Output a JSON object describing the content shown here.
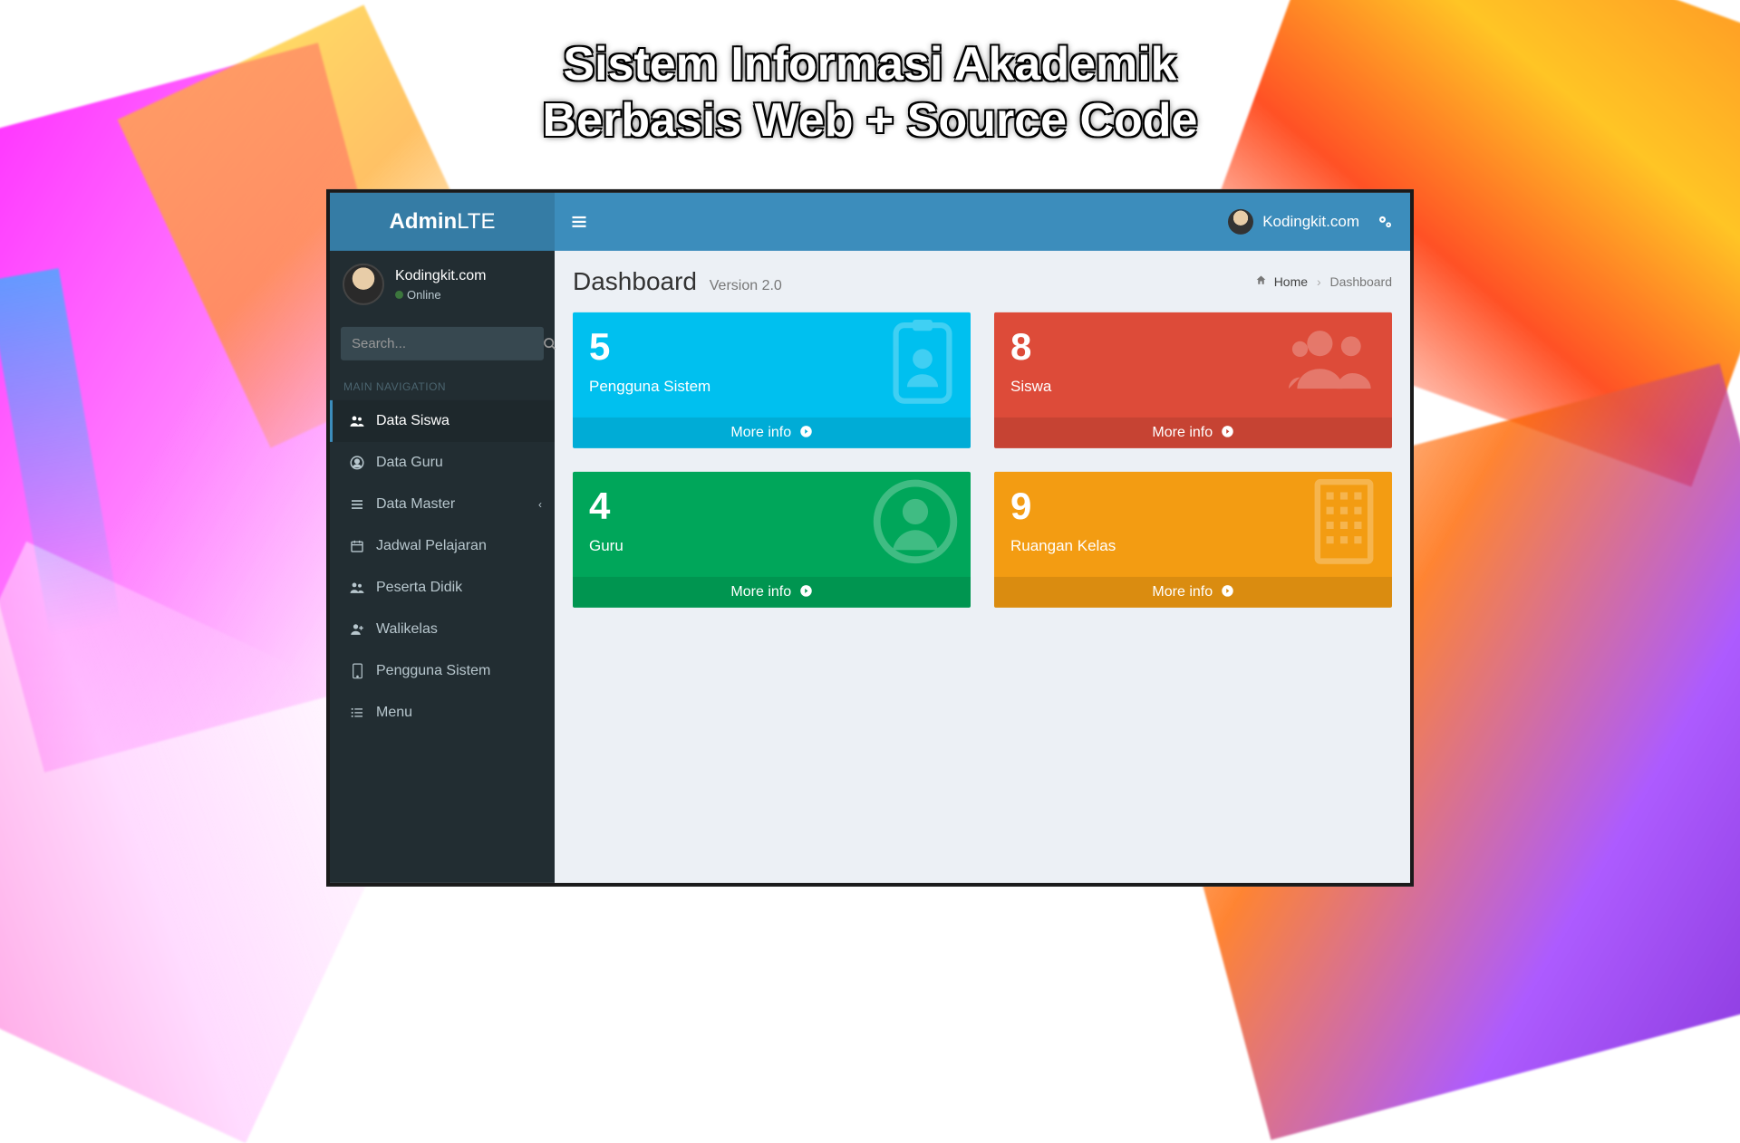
{
  "overlay": {
    "line1": "Sistem Informasi Akademik",
    "line2": "Berbasis Web + Source Code"
  },
  "logo": {
    "bold": "Admin",
    "light": "LTE"
  },
  "user": {
    "name": "Kodingkit.com",
    "status": "Online"
  },
  "search": {
    "placeholder": "Search..."
  },
  "nav": {
    "header": "MAIN NAVIGATION",
    "items": [
      {
        "label": "Data Siswa"
      },
      {
        "label": "Data Guru"
      },
      {
        "label": "Data Master"
      },
      {
        "label": "Jadwal Pelajaran"
      },
      {
        "label": "Peserta Didik"
      },
      {
        "label": "Walikelas"
      },
      {
        "label": "Pengguna Sistem"
      },
      {
        "label": "Menu"
      }
    ]
  },
  "topbar": {
    "user": "Kodingkit.com"
  },
  "header": {
    "title": "Dashboard",
    "subtitle": "Version 2.0"
  },
  "breadcrumb": {
    "home": "Home",
    "current": "Dashboard"
  },
  "boxes": [
    {
      "value": "5",
      "label": "Pengguna Sistem",
      "footer": "More info",
      "color": "aqua"
    },
    {
      "value": "8",
      "label": "Siswa",
      "footer": "More info",
      "color": "red"
    },
    {
      "value": "4",
      "label": "Guru",
      "footer": "More info",
      "color": "green"
    },
    {
      "value": "9",
      "label": "Ruangan Kelas",
      "footer": "More info",
      "color": "yellow"
    }
  ],
  "colors": {
    "aqua": "#00c0ef",
    "red": "#dd4b39",
    "green": "#00a65a",
    "yellow": "#f39c12",
    "primary": "#3c8dbc",
    "sidebar": "#222d32"
  }
}
